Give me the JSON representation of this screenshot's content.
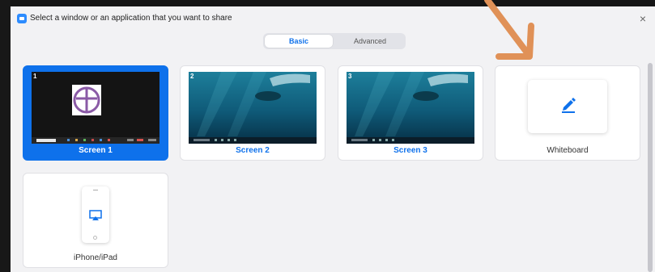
{
  "window": {
    "title": "Select a window or an application that you want to share",
    "close_glyph": "×"
  },
  "tabs": [
    {
      "label": "Basic",
      "active": true
    },
    {
      "label": "Advanced",
      "active": false
    }
  ],
  "cards": [
    {
      "label": "Screen 1",
      "number": "1",
      "selected": true
    },
    {
      "label": "Screen 2",
      "number": "2",
      "selected": false
    },
    {
      "label": "Screen 3",
      "number": "3",
      "selected": false
    },
    {
      "label": "Whiteboard",
      "icon": "pen-icon",
      "selected": false
    },
    {
      "label": "iPhone/iPad",
      "icon": "phone-cast-icon",
      "selected": false
    }
  ],
  "colors": {
    "accent": "#0e71eb",
    "arrow": "#e09157"
  }
}
